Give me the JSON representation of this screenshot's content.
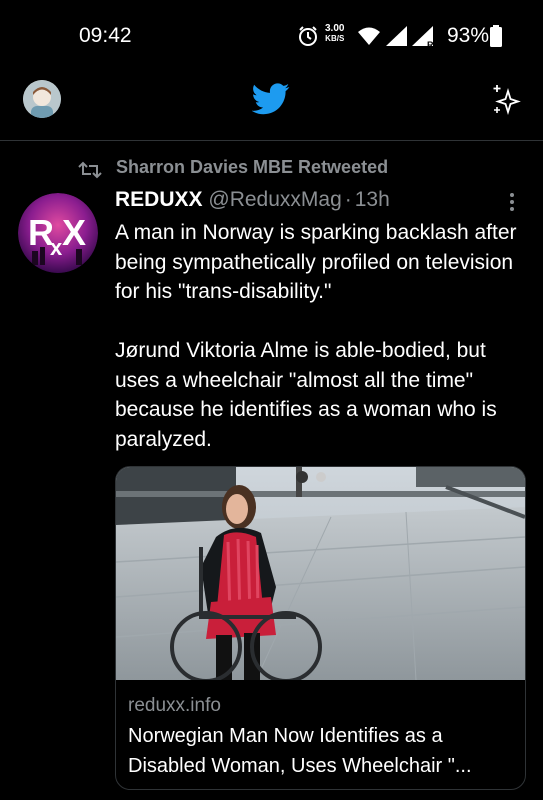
{
  "status_bar": {
    "time": "09:42",
    "net_speed_value": "3.00",
    "net_speed_unit": "KB/S",
    "signal_label": "R",
    "battery": "93%"
  },
  "header": {
    "logo_icon": "twitter-bird-icon",
    "brand_color": "#1d9bf0",
    "right_icon": "sparkle-icon"
  },
  "tweet": {
    "retweeted_by": "Sharron Davies MBE Retweeted",
    "avatar_text": "RxX",
    "author": "REDUXX",
    "handle": "@ReduxxMag",
    "separator": "·",
    "time_ago": "13h",
    "paragraph1": "A man in Norway is sparking backlash after being sympathetically profiled on television for his \"trans-disability.\"",
    "paragraph2": "Jørund Viktoria Alme is able-bodied, but uses a wheelchair \"almost all the time\" because he identifies as a woman who is paralyzed.",
    "card": {
      "domain": "reduxx.info",
      "title": "Norwegian Man Now Identifies as a Disabled Woman, Uses Wheelchair \"..."
    }
  }
}
